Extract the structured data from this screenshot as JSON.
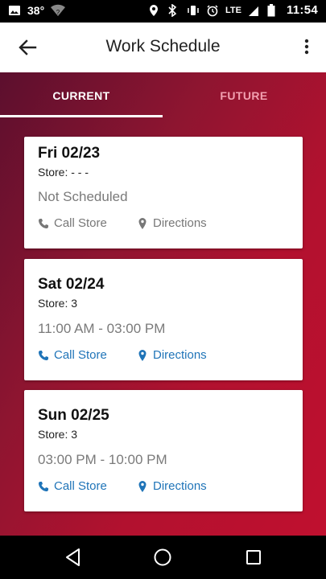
{
  "status_bar": {
    "temperature": "38°",
    "network": "LTE",
    "time": "11:54"
  },
  "app_bar": {
    "title": "Work Schedule"
  },
  "tabs": [
    {
      "label": "CURRENT",
      "selected": true
    },
    {
      "label": "FUTURE",
      "selected": false
    }
  ],
  "shifts": [
    {
      "date": "Fri 02/23",
      "store": "Store: - - -",
      "time": "Not Scheduled",
      "call_label": "Call Store",
      "directions_label": "Directions",
      "actions_enabled": false
    },
    {
      "date": "Sat 02/24",
      "store": "Store: 3",
      "time": "11:00 AM - 03:00 PM",
      "call_label": "Call Store",
      "directions_label": "Directions",
      "actions_enabled": true
    },
    {
      "date": "Sun 02/25",
      "store": "Store: 3",
      "time": "03:00 PM - 10:00 PM",
      "call_label": "Call Store",
      "directions_label": "Directions",
      "actions_enabled": true
    }
  ],
  "colors": {
    "accent": "#1f74b8",
    "background_gradient_start": "#5c0f2e",
    "background_gradient_end": "#c0102f",
    "tab_inactive": "#f2a0b0"
  }
}
